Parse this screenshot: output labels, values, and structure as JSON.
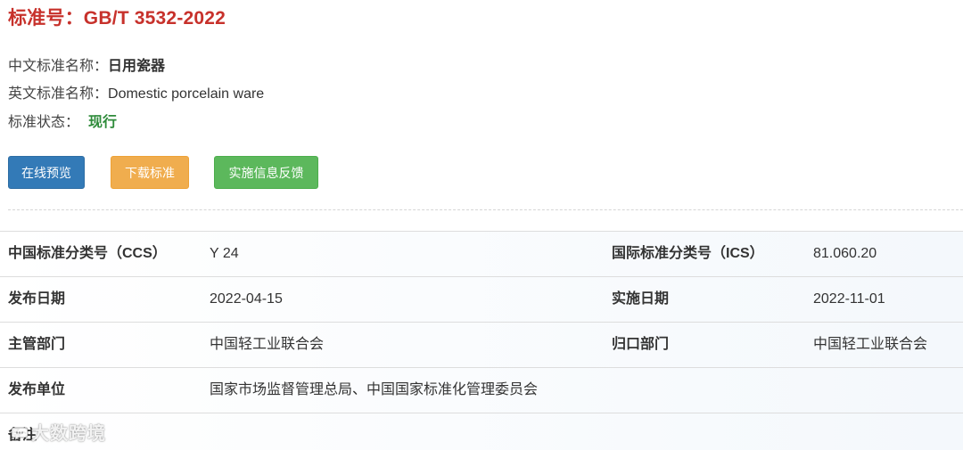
{
  "header": {
    "title": "标准号：GB/T 3532-2022"
  },
  "info": {
    "cn_name_label": "中文标准名称：",
    "cn_name_value": "日用瓷器",
    "en_name_label": "英文标准名称：",
    "en_name_value": "Domestic porcelain ware",
    "status_label": "标准状态：",
    "status_value": "现行"
  },
  "actions": {
    "preview_label": "在线预览",
    "download_label": "下载标准",
    "feedback_label": "实施信息反馈"
  },
  "details": {
    "rows": [
      {
        "label1": "中国标准分类号（CCS）",
        "value1": "Y 24",
        "label2": "国际标准分类号（ICS）",
        "value2": "81.060.20"
      },
      {
        "label1": "发布日期",
        "value1": "2022-04-15",
        "label2": "实施日期",
        "value2": "2022-11-01"
      },
      {
        "label1": "主管部门",
        "value1": "中国轻工业联合会",
        "label2": "归口部门",
        "value2": "中国轻工业联合会"
      },
      {
        "label1": "发布单位",
        "value1": "国家市场监督管理总局、中国国家标准化管理委员会",
        "label2": "",
        "value2": ""
      },
      {
        "label1": "备注",
        "value1": "",
        "label2": "",
        "value2": ""
      }
    ]
  },
  "watermark": {
    "text": "大数跨境",
    "icon": "speech-bubble-icon"
  },
  "colors": {
    "title": "#c7312b",
    "status": "#2e8b3a",
    "btn_primary": "#337ab7",
    "btn_warning": "#f0ad4e",
    "btn_success": "#5cb85c"
  }
}
